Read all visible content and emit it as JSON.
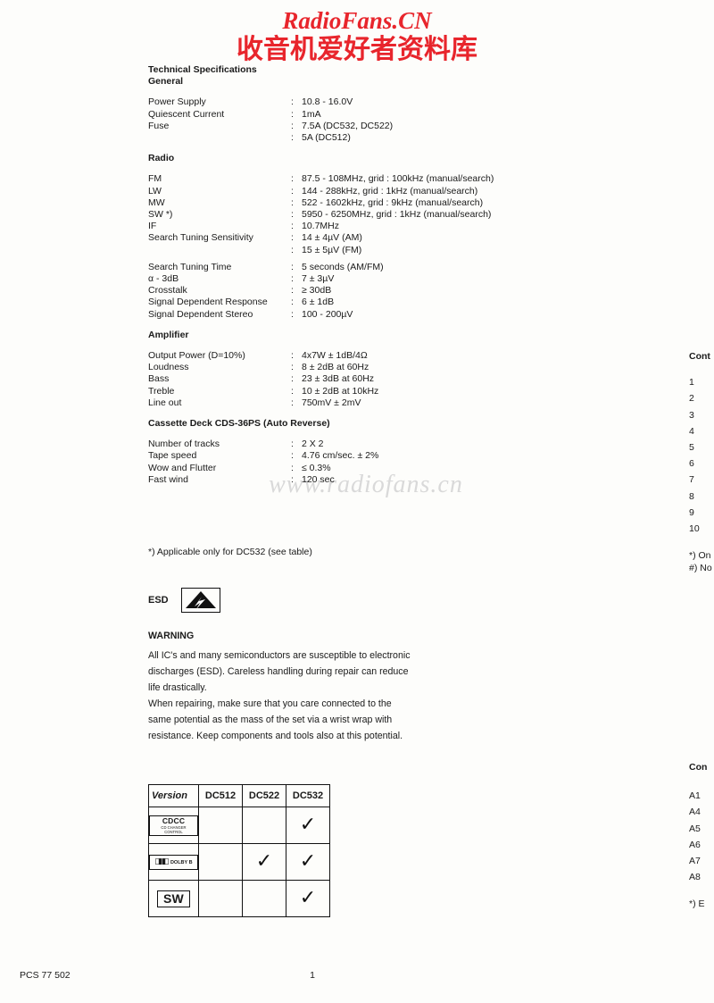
{
  "watermark": {
    "line1": "RadioFans.CN",
    "line2": "收音机爱好者资料库",
    "mid": "www.radiofans.cn"
  },
  "spec": {
    "title": "Technical Specifications",
    "sections": [
      {
        "heading": "General",
        "rows": [
          {
            "label": "Power Supply",
            "sep": ":",
            "value": "10.8 - 16.0V"
          },
          {
            "label": "Quiescent Current",
            "sep": ":",
            "value": "1mA"
          },
          {
            "label": "Fuse",
            "sep": ":",
            "value": "7.5A (DC532, DC522)"
          },
          {
            "label": "",
            "sep": ":",
            "value": "5A (DC512)"
          }
        ]
      },
      {
        "heading": "Radio",
        "rows": [
          {
            "label": "FM",
            "sep": ":",
            "value": "87.5 - 108MHz, grid : 100kHz (manual/search)"
          },
          {
            "label": "LW",
            "sep": ":",
            "value": "144 - 288kHz, grid : 1kHz (manual/search)"
          },
          {
            "label": "MW",
            "sep": ":",
            "value": "522 - 1602kHz, grid : 9kHz (manual/search)"
          },
          {
            "label": "SW *)",
            "sep": ":",
            "value": "5950 - 6250MHz, grid : 1kHz (manual/search)"
          },
          {
            "label": "IF",
            "sep": ":",
            "value": "10.7MHz"
          },
          {
            "label": "Search Tuning Sensitivity",
            "sep": ":",
            "value": "14 ± 4µV (AM)"
          },
          {
            "label": "",
            "sep": ":",
            "value": "15 ± 5µV (FM)"
          },
          {
            "label": "Search Tuning Time",
            "sep": ":",
            "value": "5 seconds (AM/FM)"
          },
          {
            "label": "α - 3dB",
            "sep": ":",
            "value": "7 ± 3µV"
          },
          {
            "label": "Crosstalk",
            "sep": ":",
            "value": "≥ 30dB"
          },
          {
            "label": "Signal Dependent Response",
            "sep": ":",
            "value": "6 ± 1dB"
          },
          {
            "label": "Signal Dependent Stereo",
            "sep": ":",
            "value": "100 - 200µV"
          }
        ]
      },
      {
        "heading": "Amplifier",
        "rows": [
          {
            "label": "Output Power (D=10%)",
            "sep": ":",
            "value": "4x7W ± 1dB/4Ω"
          },
          {
            "label": "Loudness",
            "sep": ":",
            "value": "8 ± 2dB at 60Hz"
          },
          {
            "label": "Bass",
            "sep": ":",
            "value": "23 ± 3dB at 60Hz"
          },
          {
            "label": "Treble",
            "sep": ":",
            "value": "10 ± 2dB at 10kHz"
          },
          {
            "label": "Line out",
            "sep": ":",
            "value": "750mV ± 2mV"
          }
        ]
      },
      {
        "heading": "Cassette Deck CDS-36PS (Auto Reverse)",
        "rows": [
          {
            "label": "Number of tracks",
            "sep": ":",
            "value": "2 X 2"
          },
          {
            "label": "Tape speed",
            "sep": ":",
            "value": "4.76 cm/sec. ± 2%"
          },
          {
            "label": "Wow and Flutter",
            "sep": ":",
            "value": "≤ 0.3%"
          },
          {
            "label": "Fast wind",
            "sep": ":",
            "value": "120 sec"
          }
        ]
      }
    ],
    "footnote": "*) Applicable only for DC532 (see table)"
  },
  "esd": {
    "label": "ESD"
  },
  "warning": {
    "title": "WARNING",
    "paragraphs": [
      "All IC's and many semiconductors are susceptible to electronic",
      "discharges (ESD). Careless handling during repair can reduce",
      "life drastically.",
      "When repairing, make sure that you care connected to the",
      "same potential as the mass of the set via a wrist wrap with",
      "resistance. Keep components and tools also at this potential."
    ]
  },
  "version_table": {
    "headers": [
      "Version",
      "DC512",
      "DC522",
      "DC532"
    ],
    "rows": [
      {
        "icon": "cdcc",
        "icon_label": "CDCC",
        "icon_sub": "CD CHANGER CONTROL",
        "marks": [
          "",
          "",
          "✓"
        ]
      },
      {
        "icon": "dolby",
        "icon_label": "DOLBY B",
        "icon_sub": "",
        "marks": [
          "",
          "✓",
          "✓"
        ]
      },
      {
        "icon": "sw",
        "icon_label": "SW",
        "icon_sub": "",
        "marks": [
          "",
          "",
          "✓"
        ]
      }
    ],
    "tick_glyph": "✓"
  },
  "right_column_1": {
    "heading": "Cont",
    "items": [
      "1",
      "2",
      "3",
      "4",
      "5",
      "6",
      "7",
      "8",
      "9",
      "10"
    ],
    "notes": [
      "*) On",
      "#) No"
    ]
  },
  "right_column_2": {
    "heading": "Con",
    "items": [
      "A1",
      "A4",
      "A5",
      "A6",
      "A7",
      "A8"
    ],
    "note": "*) E"
  },
  "footer": {
    "left": "PCS 77 502",
    "page": "1"
  }
}
